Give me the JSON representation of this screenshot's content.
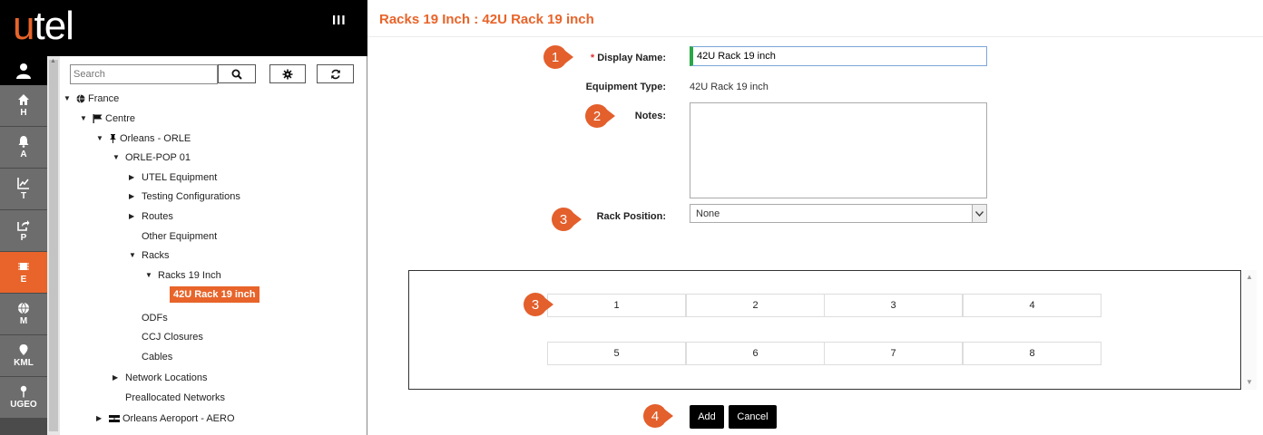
{
  "header": {
    "logo_u": "u",
    "logo_rest": "tel",
    "menu_icon": "III"
  },
  "nav": [
    {
      "label": "H",
      "icon": "home-icon"
    },
    {
      "label": "A",
      "icon": "bell-icon"
    },
    {
      "label": "T",
      "icon": "chart-icon"
    },
    {
      "label": "P",
      "icon": "share-icon"
    },
    {
      "label": "E",
      "icon": "chip-icon",
      "active": true
    },
    {
      "label": "M",
      "icon": "globe-icon"
    },
    {
      "label": "KML",
      "icon": "pin-icon"
    },
    {
      "label": "UGEO",
      "icon": "map-pin-icon"
    }
  ],
  "tree_panel": {
    "search_placeholder": "Search",
    "nodes": [
      {
        "label": "France",
        "toggle": "▼",
        "icon": "globe-small-icon"
      },
      {
        "label": "Centre",
        "toggle": "▼",
        "icon": "flag-icon"
      },
      {
        "label": "Orleans - ORLE",
        "toggle": "▼",
        "icon": "pushpin-icon"
      },
      {
        "label": "ORLE-POP 01",
        "toggle": "▼"
      },
      {
        "label": "UTEL Equipment",
        "toggle": "▶"
      },
      {
        "label": "Testing Configurations",
        "toggle": "▶"
      },
      {
        "label": "Routes",
        "toggle": "▶"
      },
      {
        "label": "Other Equipment",
        "toggle": ""
      },
      {
        "label": "Racks",
        "toggle": "▼"
      },
      {
        "label": "Racks 19 Inch",
        "toggle": "▼"
      },
      {
        "label": "42U Rack 19 inch",
        "toggle": "",
        "selected": true
      },
      {
        "label": "ODFs",
        "toggle": ""
      },
      {
        "label": "CCJ Closures",
        "toggle": ""
      },
      {
        "label": "Cables",
        "toggle": ""
      },
      {
        "label": "Network Locations",
        "toggle": "▶"
      },
      {
        "label": "Preallocated Networks",
        "toggle": ""
      },
      {
        "label": "Orleans Aeroport - AERO",
        "toggle": "▶",
        "icon": "server-icon"
      }
    ]
  },
  "page": {
    "title": "Racks 19 Inch : 42U Rack 19 inch",
    "form": {
      "required_mark": "*",
      "display_name_label": "Display Name:",
      "display_name_value": "42U Rack 19 inch",
      "equipment_type_label": "Equipment Type:",
      "equipment_type_value": "42U Rack 19 inch",
      "notes_label": "Notes:",
      "notes_value": "",
      "rack_position_label": "Rack Position:",
      "rack_position_value": "None"
    },
    "positions": [
      [
        "1",
        "2",
        "3",
        "4"
      ],
      [
        "5",
        "6",
        "7",
        "8"
      ]
    ],
    "buttons": {
      "add": "Add",
      "cancel": "Cancel"
    }
  },
  "markers": [
    "1",
    "2",
    "3",
    "3",
    "4"
  ],
  "colors": {
    "accent": "#e8642a",
    "nav": "#6d6d6d",
    "marker": "#e35f2c"
  }
}
